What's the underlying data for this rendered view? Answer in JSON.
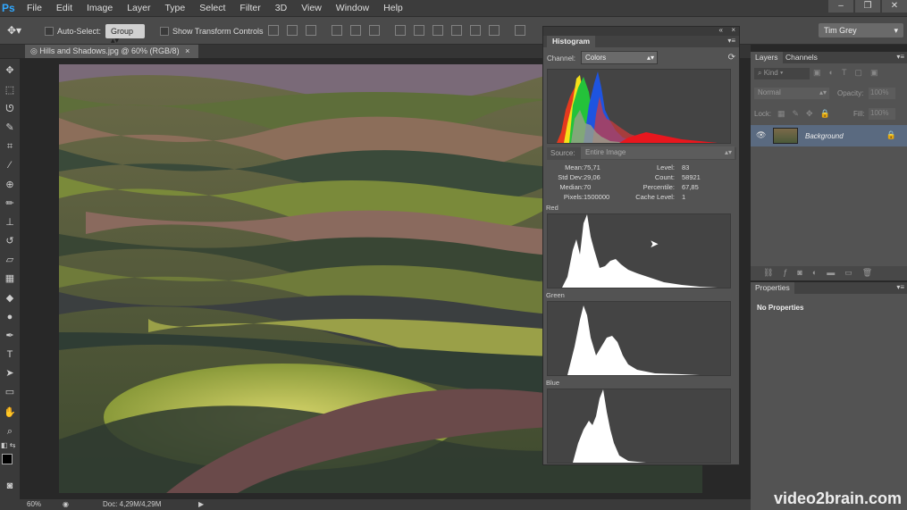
{
  "app": {
    "logo": "Ps"
  },
  "menu": [
    "File",
    "Edit",
    "Image",
    "Layer",
    "Type",
    "Select",
    "Filter",
    "3D",
    "View",
    "Window",
    "Help"
  ],
  "window_controls": {
    "minimize": "–",
    "maximize": "❐",
    "close": "✕"
  },
  "options_bar": {
    "auto_select_label": "Auto-Select:",
    "auto_select_value": "Group",
    "transform_label": "Show Transform Controls",
    "workspace": "Tim Grey"
  },
  "document": {
    "tab_title": "Hills and Shadows.jpg @ 60% (RGB/8)",
    "close": "×"
  },
  "status": {
    "zoom": "60%",
    "doc_info": "Doc: 4,29M/4,29M"
  },
  "histogram": {
    "title": "Histogram",
    "channel_label": "Channel:",
    "channel_value": "Colors",
    "source_label": "Source:",
    "source_value": "Entire Image",
    "stats": {
      "mean_label": "Mean:",
      "mean": "75,71",
      "std_label": "Std Dev:",
      "std": "29,06",
      "median_label": "Median:",
      "median": "70",
      "pixels_label": "Pixels:",
      "pixels": "1500000",
      "level_label": "Level:",
      "level": "83",
      "count_label": "Count:",
      "count": "58921",
      "percentile_label": "Percentile:",
      "percentile": "67,85",
      "cache_label": "Cache Level:",
      "cache": "1"
    },
    "channels": [
      "Red",
      "Green",
      "Blue"
    ]
  },
  "layers": {
    "tab_layers": "Layers",
    "tab_channels": "Channels",
    "kind": "Kind",
    "blend": "Normal",
    "opacity_label": "Opacity:",
    "opacity": "100%",
    "lock_label": "Lock:",
    "fill_label": "Fill:",
    "fill": "100%",
    "layer_name": "Background"
  },
  "properties": {
    "title": "Properties",
    "empty": "No Properties"
  },
  "watermark": "video2brain.com",
  "colors": {
    "accent": "#31a8ff",
    "panel": "#535353",
    "selected_layer": "#5a6a80"
  }
}
